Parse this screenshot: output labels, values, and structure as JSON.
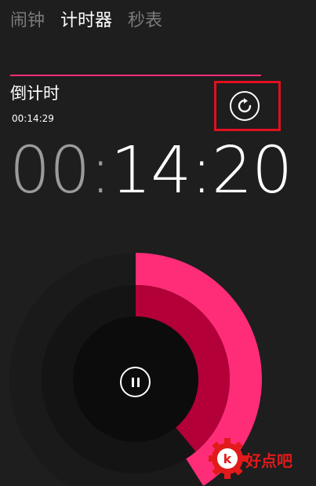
{
  "tabs": [
    {
      "label": "闹钟",
      "active": false
    },
    {
      "label": "计时器",
      "active": true
    },
    {
      "label": "秒表",
      "active": false
    }
  ],
  "timer": {
    "name": "倒计时",
    "set_duration": "00:14:29",
    "remaining": {
      "hours": "00",
      "sep": ":",
      "rest": "14:20"
    },
    "progress_remaining_fraction": 0.41,
    "reset_icon": "refresh-icon",
    "pause_icon": "pause-icon"
  },
  "watermark": {
    "text": "好点吧"
  },
  "colors": {
    "accent": "#ff2d78",
    "accent_dark": "#b30038",
    "background": "#1e1e1e",
    "highlight_box": "#e0101e"
  }
}
